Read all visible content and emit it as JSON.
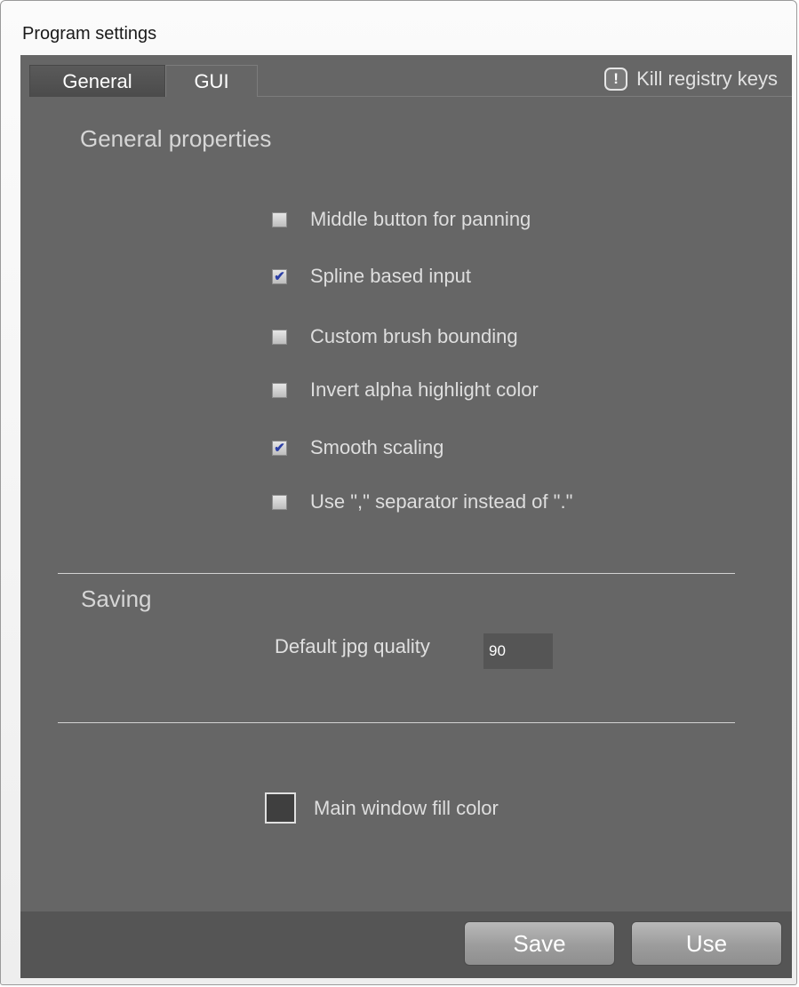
{
  "window": {
    "title": "Program settings"
  },
  "tabs": [
    {
      "label": "General",
      "active": false
    },
    {
      "label": "GUI",
      "active": true
    }
  ],
  "kill_registry": {
    "icon": "exclamation-icon",
    "icon_glyph": "!",
    "label": "Kill registry keys"
  },
  "general_properties": {
    "title": "General properties",
    "options": [
      {
        "label": "Middle button for panning",
        "checked": false
      },
      {
        "label": "Spline based input",
        "checked": true
      },
      {
        "label": "Custom brush bounding",
        "checked": false
      },
      {
        "label": "Invert alpha highlight color",
        "checked": false
      },
      {
        "label": "Smooth scaling",
        "checked": true
      },
      {
        "label": "Use \",\" separator instead of \".\"",
        "checked": false
      }
    ]
  },
  "saving": {
    "title": "Saving",
    "jpg_quality_label": "Default jpg quality",
    "jpg_quality_value": "90"
  },
  "fill_color": {
    "label": "Main window fill color",
    "color": "#3f3f3f"
  },
  "footer": {
    "save_label": "Save",
    "use_label": "Use"
  },
  "colors": {
    "panel": "#666666",
    "footer": "#555555",
    "check": "#2c3fa6"
  }
}
